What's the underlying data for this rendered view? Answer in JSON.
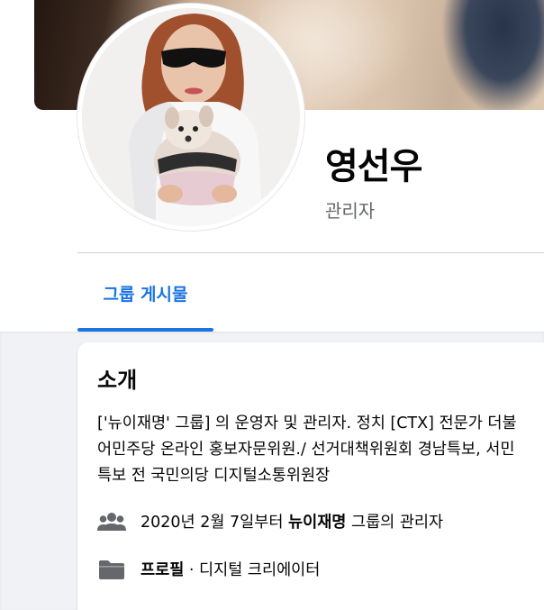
{
  "cover": {
    "description_icon": "cover-photo"
  },
  "profile": {
    "name": "영선우",
    "role": "관리자"
  },
  "tabs": [
    {
      "label": "그룹 게시물",
      "active": true
    }
  ],
  "intro": {
    "title": "소개",
    "text": "['뉴이재명' 그룹] 의 운영자 및 관리자. 정치 [CTX] 전문가 더불어민주당 온라인 홍보자문위원./ 선거대책위원회 경남특보, 서민특보 전 국민의당 디지털소통위원장",
    "admin_row": {
      "icon": "group-icon",
      "prefix": "2020년 2월 7일부터 ",
      "group_name": "뉴이재명",
      "suffix": " 그룹의 관리자"
    },
    "profile_row": {
      "icon": "folder-icon",
      "label": "프로필",
      "suffix": " · 디지털 크리에이터"
    }
  },
  "colors": {
    "accent": "#1b74e4",
    "secondary_text": "#65676b",
    "background": "#f0f2f5",
    "icon_gray": "#65676b"
  }
}
